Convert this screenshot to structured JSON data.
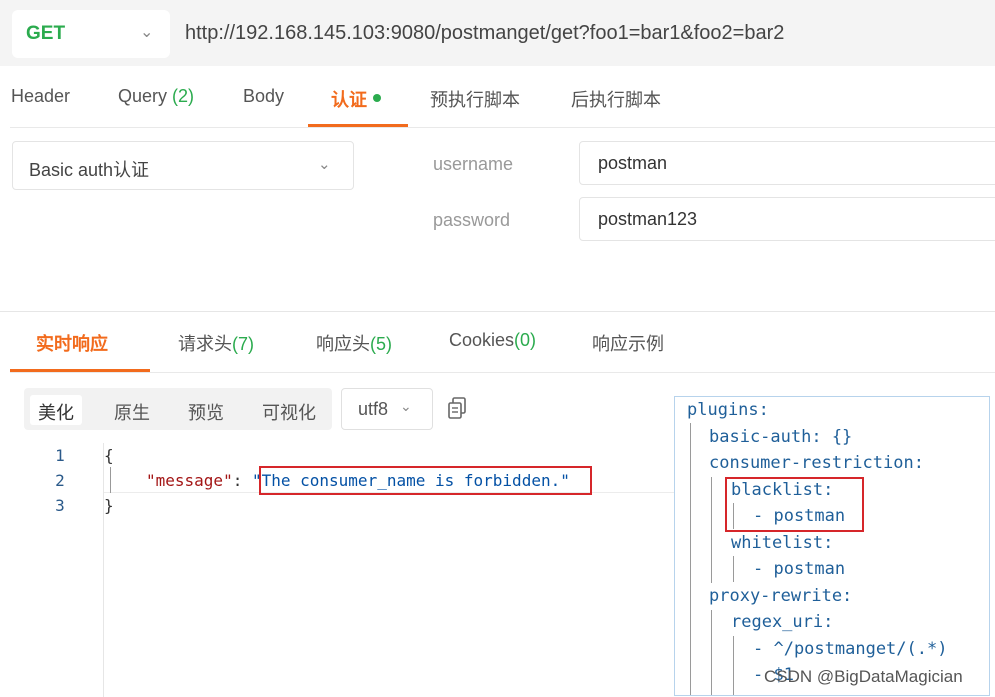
{
  "request": {
    "method": "GET",
    "url": "http://192.168.145.103:9080/postmanget/get?foo1=bar1&foo2=bar2"
  },
  "request_tabs": {
    "header": "Header",
    "query": "Query",
    "query_count": "(2)",
    "body": "Body",
    "auth": "认证",
    "pre_script": "预执行脚本",
    "post_script": "后执行脚本"
  },
  "auth": {
    "type": "Basic auth认证",
    "username_label": "username",
    "username_value": "postman",
    "password_label": "password",
    "password_value": "postman123"
  },
  "response_tabs": {
    "realtime": "实时响应",
    "req_headers": "请求头",
    "req_headers_count": "(7)",
    "resp_headers": "响应头",
    "resp_headers_count": "(5)",
    "cookies": "Cookies",
    "cookies_count": "(0)",
    "example": "响应示例"
  },
  "view": {
    "pretty": "美化",
    "raw": "原生",
    "preview": "预览",
    "visualize": "可视化",
    "encoding": "utf8"
  },
  "response_body": {
    "line_numbers": [
      "1",
      "2",
      "3"
    ],
    "open_brace": "{",
    "key": "\"message\"",
    "colon": ": ",
    "value": "\"The consumer_name is forbidden.\"",
    "close_brace": "}"
  },
  "yaml": {
    "lines": [
      "plugins:",
      "basic-auth: {}",
      "consumer-restriction:",
      "blacklist:",
      "- postman",
      "whitelist:",
      "- postman",
      "proxy-rewrite:",
      "regex_uri:",
      "- ^/postmanget/(.*)",
      "- $1"
    ]
  },
  "watermark": "CSDN @BigDataMagician",
  "colors": {
    "accent": "#f26b1d",
    "method_green": "#2bab4e",
    "highlight_red": "#d6262a"
  },
  "icons": [
    "chevron-down-icon",
    "copy-icon",
    "status-dot-icon"
  ]
}
